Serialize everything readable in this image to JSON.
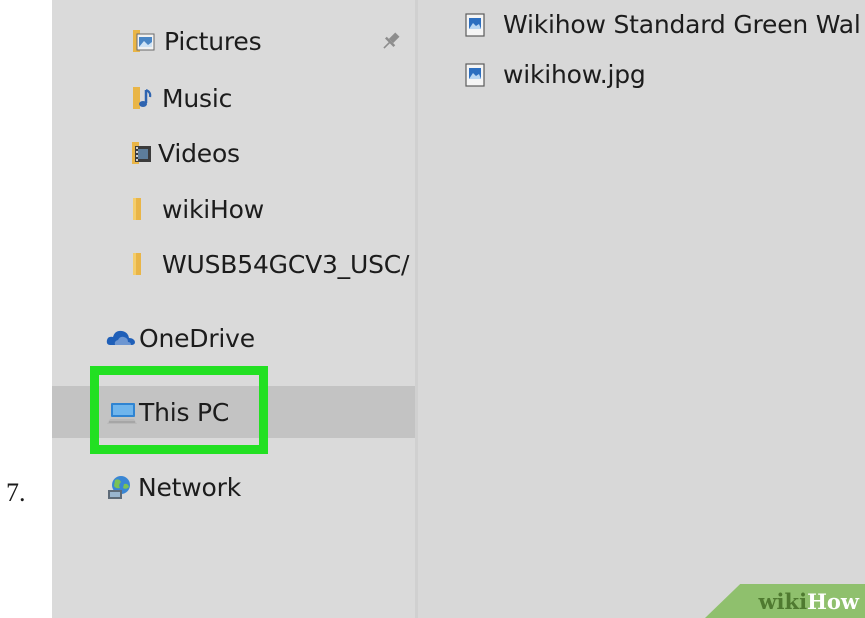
{
  "step": {
    "number": "7."
  },
  "nav": {
    "items": [
      {
        "label": "Pictures",
        "icon": "pictures-folder-icon",
        "pinned": true
      },
      {
        "label": "Music",
        "icon": "music-folder-icon"
      },
      {
        "label": "Videos",
        "icon": "videos-folder-icon"
      },
      {
        "label": "wikiHow",
        "icon": "folder-icon"
      },
      {
        "label": "WUSB54GCV3_USC/",
        "icon": "folder-icon"
      },
      {
        "label": "OneDrive",
        "icon": "onedrive-icon"
      },
      {
        "label": "This PC",
        "icon": "this-pc-icon",
        "selected": true,
        "highlighted": true
      },
      {
        "label": "Network",
        "icon": "network-icon"
      }
    ]
  },
  "files": [
    {
      "label": "Wikihow Standard Green Wal",
      "icon": "image-file-icon"
    },
    {
      "label": "wikihow.jpg",
      "icon": "image-file-icon"
    }
  ],
  "watermark": {
    "part1": "wiki",
    "part2": "How"
  },
  "colors": {
    "highlight": "#22e022",
    "nav_background": "#dadada",
    "selected_row": "#c3c3c3",
    "content_background": "#d8d8d8",
    "watermark_green": "#8fc06d"
  }
}
